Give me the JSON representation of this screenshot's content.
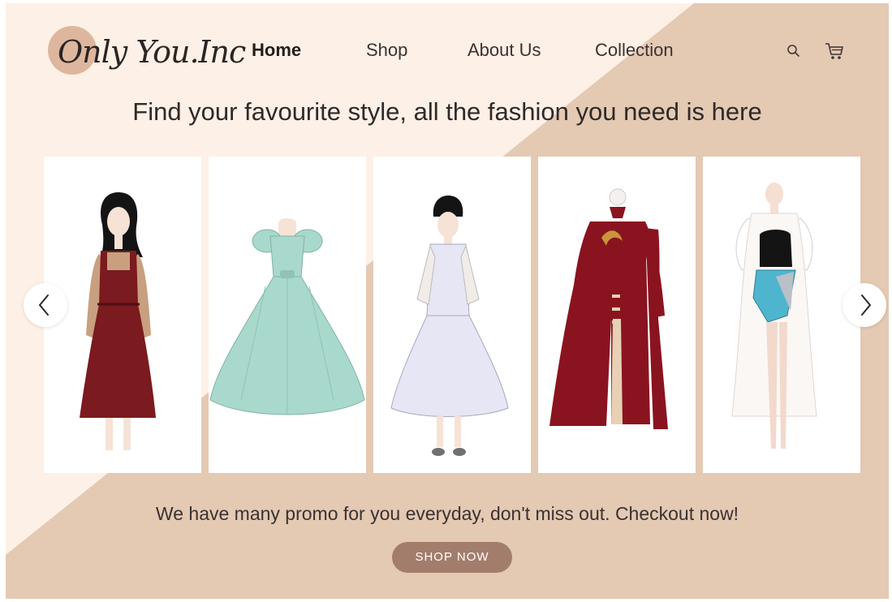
{
  "brand": {
    "logo_text": "Only You.Inc"
  },
  "nav": {
    "items": [
      {
        "label": "Home",
        "active": true
      },
      {
        "label": "Shop",
        "active": false
      },
      {
        "label": "About Us",
        "active": false
      },
      {
        "label": "Collection",
        "active": false
      }
    ]
  },
  "header_icons": [
    "search-icon",
    "cart-icon"
  ],
  "hero": {
    "headline": "Find your favourite style, all the fashion you need is here"
  },
  "carousel": {
    "prev_icon": "chevron-left-icon",
    "next_icon": "chevron-right-icon",
    "items": [
      {
        "illustration": "burgundy pinafore dress with tan sleeves"
      },
      {
        "illustration": "mint puff-sleeve ball gown"
      },
      {
        "illustration": "lavender cheongsam-style dress"
      },
      {
        "illustration": "dark red embroidered long coat dress"
      },
      {
        "illustration": "white sheer outfit with blue sequin skirt"
      }
    ]
  },
  "promo": {
    "text": "We have many promo for you everyday, don't miss out. Checkout now!"
  },
  "cta": {
    "label": "SHOP NOW"
  },
  "colors": {
    "background_light": "#fdf0e6",
    "background_tan": "#e4c9b3",
    "logo_circle": "#ddb79d",
    "button": "#a37d6b",
    "burgundy": "#7b1a1f",
    "mint": "#a9d8cc",
    "lavender": "#e6e6f4",
    "crimson": "#8a1320",
    "sequin_blue": "#4fb5cf"
  }
}
